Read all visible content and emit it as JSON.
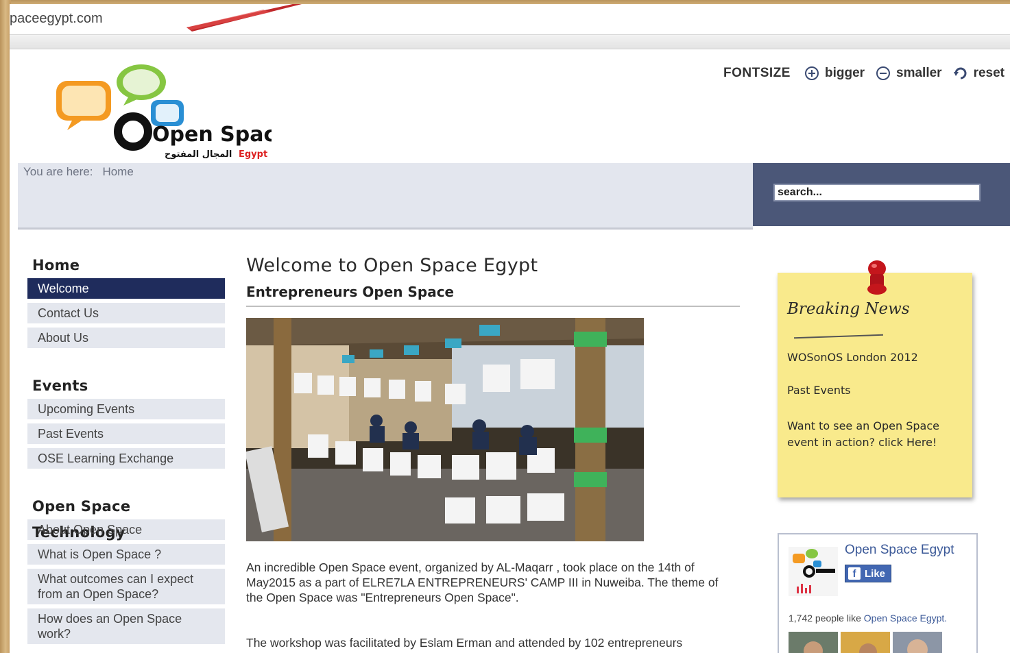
{
  "browser": {
    "url": "paceegypt.com"
  },
  "header": {
    "logo_text": "Open Space",
    "logo_arabic": "المجال المفتوح",
    "logo_country": "Egypt",
    "fontsize_label": "FONTSIZE",
    "bigger": "bigger",
    "smaller": "smaller",
    "reset": "reset"
  },
  "breadcrumb": {
    "prefix": "You are here:",
    "home": "Home"
  },
  "search": {
    "placeholder": "search..."
  },
  "sidebar": {
    "sections": [
      {
        "title": "Home",
        "items": [
          "Welcome",
          "Contact Us",
          "About Us"
        ]
      },
      {
        "title": "Events",
        "items": [
          "Upcoming Events",
          "Past Events",
          "OSE Learning Exchange"
        ]
      },
      {
        "title": "Open Space Technology",
        "items": [
          "About Open Space",
          "What is Open Space ?",
          "What outcomes can I expect from an Open Space?",
          "How does an Open Space work?"
        ]
      }
    ],
    "active": "Welcome"
  },
  "main": {
    "title": "Welcome to Open Space Egypt",
    "subtitle": "Entrepreneurs Open Space",
    "paragraph1": "An incredible Open Space event, organized by AL-Maqarr , took place on the 14th of May2015 as a part of ELRE7LA ENTREPRENEURS' CAMP III in Nuweiba. The theme of the Open Space was \"Entrepreneurs Open Space\".",
    "paragraph2": "The workshop was facilitated by Eslam Erman and attended by 102 entrepreneurs"
  },
  "note": {
    "title": "Breaking News",
    "link1": "WOSonOS London 2012",
    "link2": "Past Events",
    "link3": "Want to see an Open Space event in action? click Here!"
  },
  "facebook": {
    "page_name": "Open Space Egypt",
    "like": "Like",
    "count_text": "1,742 people like",
    "count_link": "Open Space Egypt."
  },
  "colors": {
    "nav_active": "#1f2c5c",
    "search_bg": "#4b5778",
    "note_bg": "#f9ea8c",
    "fb_blue": "#3b5998"
  }
}
